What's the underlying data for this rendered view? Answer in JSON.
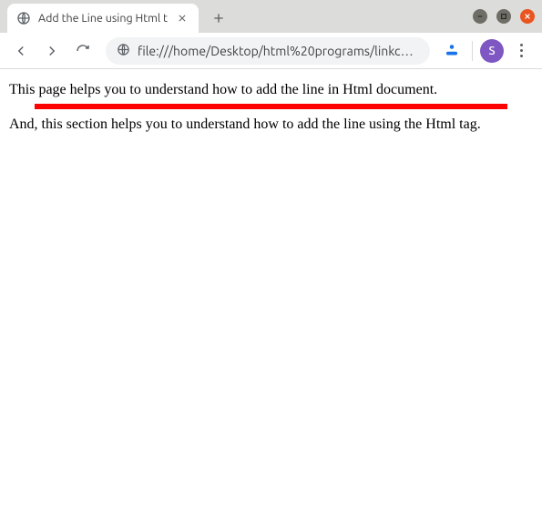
{
  "window": {
    "title": "Add the Line using Html t"
  },
  "tab": {
    "title": "Add the Line using Html t"
  },
  "toolbar": {
    "url": "file:///home/Desktop/html%20programs/linkc…"
  },
  "avatar": {
    "initial": "S"
  },
  "page": {
    "paragraph1": "This page helps you to understand how to add the line in Html document.",
    "paragraph2": "And, this section helps you to understand how to add the line using the Html tag.",
    "line_color": "#ff0000"
  }
}
